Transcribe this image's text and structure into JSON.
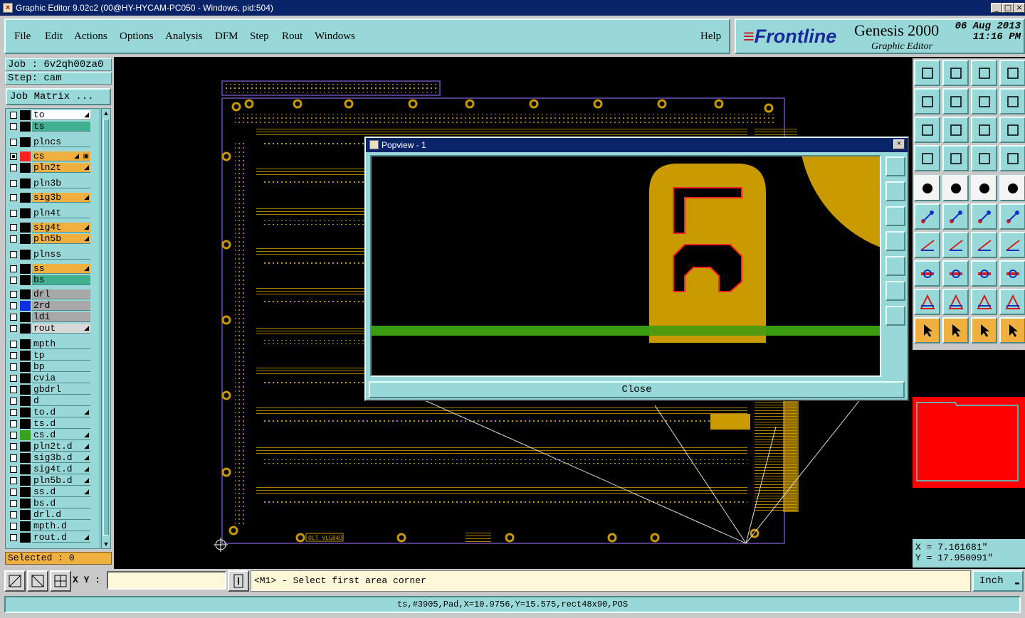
{
  "window": {
    "title": "Graphic Editor 9.02c2 (00@HY-HYCAM-PC050 - Windows, pid:504)",
    "controls": [
      "_",
      "□",
      "×"
    ]
  },
  "menu": [
    "File",
    "Edit",
    "Actions",
    "Options",
    "Analysis",
    "DFM",
    "Step",
    "Rout",
    "Windows"
  ],
  "help_label": "Help",
  "brand": {
    "logo": "Frontline",
    "product": "Genesis 2000",
    "subtitle": "Graphic Editor",
    "date": "06 Aug 2013",
    "time": "11:16 PM"
  },
  "job": {
    "label": "Job : 6v2qh00za0",
    "step": "Step: cam"
  },
  "job_matrix_label": "Job Matrix ...",
  "layers": [
    {
      "name": "to",
      "style": "wh",
      "color": "#000000",
      "checked": false,
      "mark": "◢"
    },
    {
      "name": "ts",
      "style": "gr",
      "color": "#000000",
      "checked": false,
      "mark": ""
    },
    {
      "name": "plncs",
      "style": "def",
      "color": "#000000",
      "checked": false,
      "mark": ""
    },
    {
      "name": "cs",
      "style": "or",
      "color": "#ff2020",
      "checked": true,
      "mark": "◢ ▣"
    },
    {
      "name": "pln2t",
      "style": "or",
      "color": "#000000",
      "checked": false,
      "mark": "◢"
    },
    {
      "name": "pln3b",
      "style": "def",
      "color": "#000000",
      "checked": false,
      "mark": ""
    },
    {
      "name": "sig3b",
      "style": "or",
      "color": "#000000",
      "checked": false,
      "mark": "◢"
    },
    {
      "name": "pln4t",
      "style": "def",
      "color": "#000000",
      "checked": false,
      "mark": ""
    },
    {
      "name": "sig4t",
      "style": "or",
      "color": "#000000",
      "checked": false,
      "mark": "◢"
    },
    {
      "name": "pln5b",
      "style": "or",
      "color": "#000000",
      "checked": false,
      "mark": "◢"
    },
    {
      "name": "plnss",
      "style": "def",
      "color": "#000000",
      "checked": false,
      "mark": ""
    },
    {
      "name": "ss",
      "style": "or",
      "color": "#000000",
      "checked": false,
      "mark": "◢"
    },
    {
      "name": "bs",
      "style": "gr",
      "color": "#000000",
      "checked": false,
      "mark": ""
    },
    {
      "name": "drl",
      "style": "gy",
      "color": "#000000",
      "checked": false,
      "mark": ""
    },
    {
      "name": "2rd",
      "style": "gy",
      "color": "#1030e0",
      "checked": false,
      "mark": ""
    },
    {
      "name": "ldi",
      "style": "gy",
      "color": "#000000",
      "checked": false,
      "mark": ""
    },
    {
      "name": "rout",
      "style": "lg",
      "color": "#000000",
      "checked": false,
      "mark": "◢"
    },
    {
      "name": "mpth",
      "style": "def",
      "color": "#000000",
      "checked": false,
      "mark": ""
    },
    {
      "name": "tp",
      "style": "def",
      "color": "#000000",
      "checked": false,
      "mark": ""
    },
    {
      "name": "bp",
      "style": "def",
      "color": "#000000",
      "checked": false,
      "mark": ""
    },
    {
      "name": "cvia",
      "style": "def",
      "color": "#000000",
      "checked": false,
      "mark": ""
    },
    {
      "name": "gbdrl",
      "style": "def",
      "color": "#000000",
      "checked": false,
      "mark": ""
    },
    {
      "name": "d",
      "style": "def",
      "color": "#000000",
      "checked": false,
      "mark": ""
    },
    {
      "name": "to.d",
      "style": "def",
      "color": "#000000",
      "checked": false,
      "mark": "◢"
    },
    {
      "name": "ts.d",
      "style": "def",
      "color": "#000000",
      "checked": false,
      "mark": ""
    },
    {
      "name": "cs.d",
      "style": "def",
      "color": "#3aa020",
      "checked": false,
      "mark": "◢"
    },
    {
      "name": "pln2t.d",
      "style": "def",
      "color": "#000000",
      "checked": false,
      "mark": "◢"
    },
    {
      "name": "sig3b.d",
      "style": "def",
      "color": "#000000",
      "checked": false,
      "mark": "◢"
    },
    {
      "name": "sig4t.d",
      "style": "def",
      "color": "#000000",
      "checked": false,
      "mark": "◢"
    },
    {
      "name": "pln5b.d",
      "style": "def",
      "color": "#000000",
      "checked": false,
      "mark": "◢"
    },
    {
      "name": "ss.d",
      "style": "def",
      "color": "#000000",
      "checked": false,
      "mark": "◢"
    },
    {
      "name": "bs.d",
      "style": "def",
      "color": "#000000",
      "checked": false,
      "mark": ""
    },
    {
      "name": "drl.d",
      "style": "def",
      "color": "#000000",
      "checked": false,
      "mark": ""
    },
    {
      "name": "mpth.d",
      "style": "def",
      "color": "#000000",
      "checked": false,
      "mark": ""
    },
    {
      "name": "rout.d",
      "style": "def",
      "color": "#000000",
      "checked": false,
      "mark": "◢"
    }
  ],
  "selected_label": "Selected : 0",
  "board_labels": {
    "silk1": "OLT VLG84D"
  },
  "popview": {
    "title": "Popview - 1",
    "close_label": "Close"
  },
  "coordinates": {
    "x": "X = 7.161681\"",
    "y": "Y = 17.950091\""
  },
  "xy_label": "X Y :",
  "xy_value": "",
  "prompt_text": "<M1> - Select first area corner",
  "units": "Inch",
  "status_line": "ts,#3905,Pad,X=10.9756,Y=15.575,rect48x90,POS",
  "colors": {
    "accent": "#98d8d8",
    "copper": "#c89a00",
    "highlight": "#f0b040",
    "selection": "#ff0000"
  }
}
